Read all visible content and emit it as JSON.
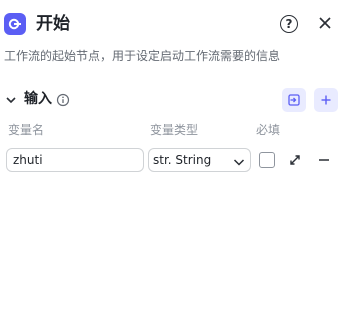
{
  "header": {
    "title": "开始",
    "logo_icon": "start-node-icon",
    "help_icon": "question-circle-icon",
    "help_glyph": "?",
    "close_icon": "close-icon"
  },
  "subtitle": "工作流的起始节点，用于设定启动工作流需要的信息",
  "input_section": {
    "title": "输入",
    "collapse_icon": "chevron-down-icon",
    "info_icon": "info-icon",
    "import_icon": "import-icon",
    "add_icon": "plus-icon",
    "columns": [
      "变量名",
      "变量类型",
      "必填"
    ],
    "rows": [
      {
        "name": "zhuti",
        "type": "str. String",
        "required": false,
        "expand_icon": "expand-icon",
        "remove_icon": "minus-icon"
      }
    ]
  },
  "colors": {
    "accent": "#5b5ef4",
    "accent_soft": "#e9ebff",
    "text": "#1f2329",
    "muted": "#8f959e",
    "border": "#d0d3d6"
  }
}
